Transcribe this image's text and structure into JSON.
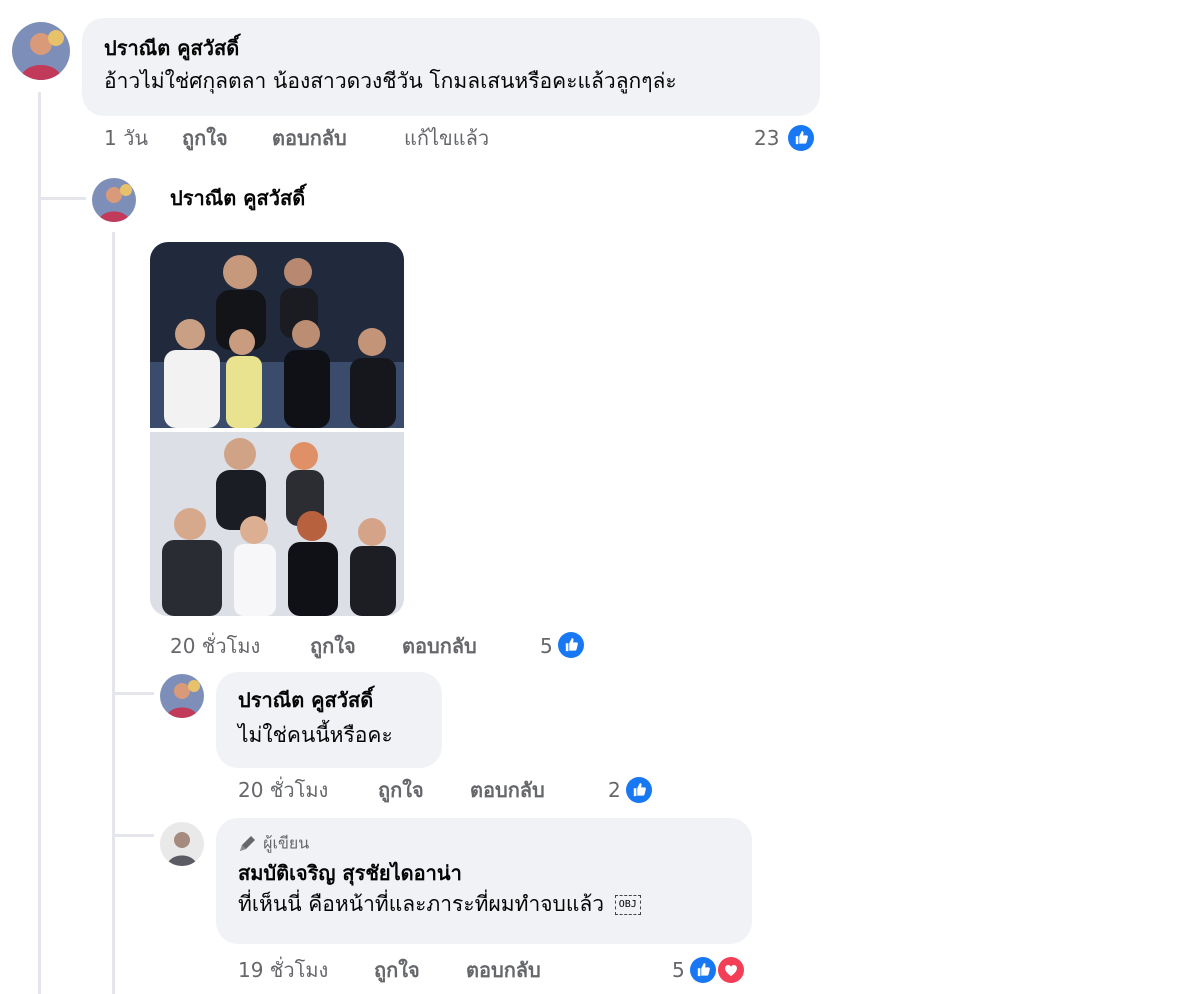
{
  "colors": {
    "bubble": "#f0f2f5",
    "secondary_text": "#65676b",
    "like_blue": "#1877f2",
    "love_red": "#f33e58",
    "thread_line": "#e4e6eb"
  },
  "comments": [
    {
      "author": "ปราณีต คูสวัสดิ์",
      "text": "อ้าวไม่ใช่ศกุลตลา น้องสาวดวงชีวัน โกมลเสนหรือคะแล้วลูกๆล่ะ",
      "time": "1 วัน",
      "like_label": "ถูกใจ",
      "reply_label": "ตอบกลับ",
      "edited_label": "แก้ไขแล้ว",
      "reaction_count": "23",
      "reactions": [
        "like-icon"
      ]
    },
    {
      "author": "ปราณีต คูสวัสดิ์",
      "attachment": "photo",
      "time": "20 ชั่วโมง",
      "like_label": "ถูกใจ",
      "reply_label": "ตอบกลับ",
      "reaction_count": "5",
      "reactions": [
        "like-icon"
      ]
    },
    {
      "author": "ปราณีต คูสวัสดิ์",
      "text": "ไม่ใช่คนนี้หรือคะ",
      "time": "20 ชั่วโมง",
      "like_label": "ถูกใจ",
      "reply_label": "ตอบกลับ",
      "reaction_count": "2",
      "reactions": [
        "like-icon"
      ]
    },
    {
      "badge": "ผู้เขียน",
      "badge_icon": "pencil-icon",
      "author": "สมบัติเจริญ สุรชัยไดอาน่า",
      "text": "ที่เห็นนี่ คือหน้าที่และภาระที่ผมทำจบแล้ว",
      "emoji": "OBJ",
      "time": "19 ชั่วโมง",
      "like_label": "ถูกใจ",
      "reply_label": "ตอบกลับ",
      "reaction_count": "5",
      "reactions": [
        "like-icon",
        "love-icon"
      ]
    }
  ]
}
